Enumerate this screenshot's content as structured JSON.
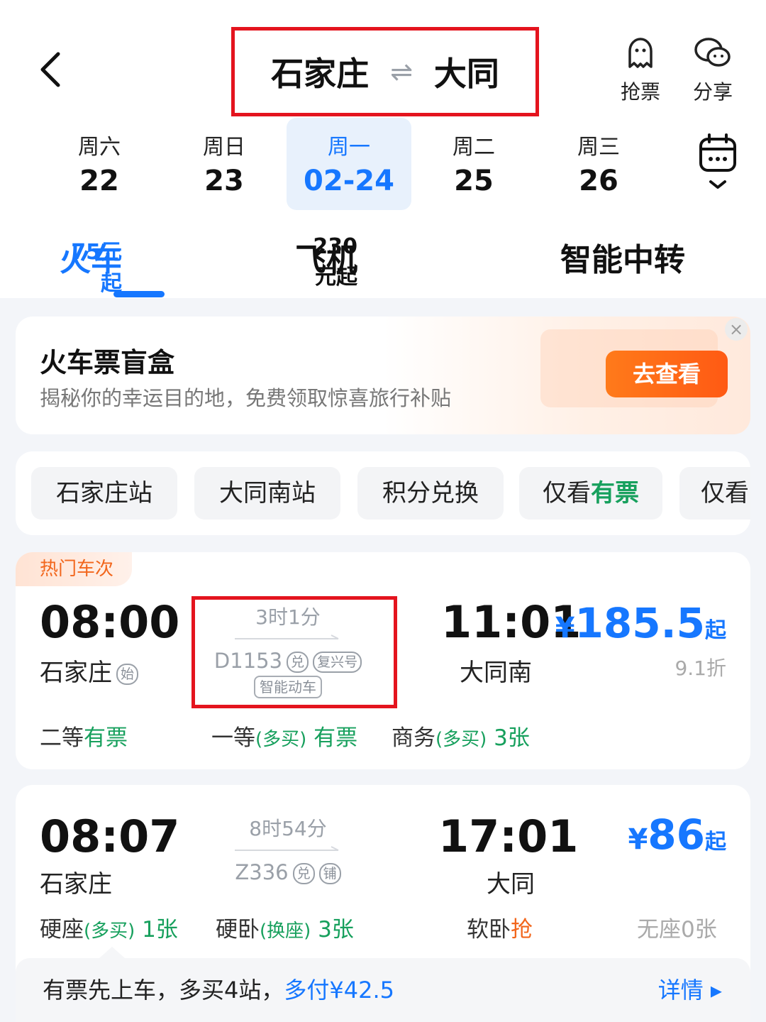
{
  "header": {
    "from_city": "石家庄",
    "swap_symbol": "⇌",
    "to_city": "大同",
    "grab_label": "抢票",
    "share_label": "分享"
  },
  "dates": [
    {
      "weekday": "周六",
      "date": "22",
      "selected": false
    },
    {
      "weekday": "周日",
      "date": "23",
      "selected": false
    },
    {
      "weekday": "周一",
      "date": "02-24",
      "selected": true
    },
    {
      "weekday": "周二",
      "date": "25",
      "selected": false
    },
    {
      "weekday": "周三",
      "date": "26",
      "selected": false
    }
  ],
  "modes": [
    {
      "name": "火车",
      "price": "75元起",
      "active": true
    },
    {
      "name": "飞机",
      "price": "230元起",
      "active": false
    },
    {
      "name": "智能中转",
      "price": "",
      "active": false
    }
  ],
  "banner": {
    "title": "火车票盲盒",
    "subtitle": "揭秘你的幸运目的地，免费领取惊喜旅行补贴",
    "button": "去查看",
    "close": "×"
  },
  "filters": [
    "石家庄站",
    "大同南站",
    "积分兑换",
    "仅看",
    "有票",
    "仅看"
  ],
  "trains": [
    {
      "tag": "热门车次",
      "dep_time": "08:00",
      "dep_station": "石家庄",
      "dep_badge": "始",
      "duration": "3时1分",
      "number": "D1153",
      "num_badges": [
        "兑",
        "复兴号"
      ],
      "type_tag": "智能动车",
      "arr_time": "11:01",
      "arr_station": "大同南",
      "currency": "¥",
      "price": "185.5",
      "price_suffix": "起",
      "discount": "9.1折",
      "seats": [
        {
          "name": "二等",
          "note": "",
          "status": "有票"
        },
        {
          "name": "一等",
          "note": "(多买)",
          "status": "有票"
        },
        {
          "name": "商务",
          "note": "(多买)",
          "status": "3张"
        }
      ]
    },
    {
      "dep_time": "08:07",
      "dep_station": "石家庄",
      "duration": "8时54分",
      "number": "Z336",
      "num_badges": [
        "兑",
        "铺"
      ],
      "arr_time": "17:01",
      "arr_station": "大同",
      "currency": "¥",
      "price": "86",
      "price_suffix": "起",
      "seats": [
        {
          "name": "硬座",
          "note": "(多买)",
          "status": "1张"
        },
        {
          "name": "硬卧",
          "note": "(换座)",
          "status": "3张"
        },
        {
          "name": "软卧",
          "note": "",
          "status": "抢"
        },
        {
          "name": "无座",
          "note": "",
          "status": "0张"
        }
      ],
      "bottom": {
        "text": "有票先上车，多买4站，",
        "extra": "多付¥42.5",
        "more": "详情 ▸"
      }
    }
  ],
  "colors": {
    "accent": "#1677ff",
    "green": "#17a05d",
    "orange": "#f2661c",
    "highlight_box": "#e4141e"
  }
}
